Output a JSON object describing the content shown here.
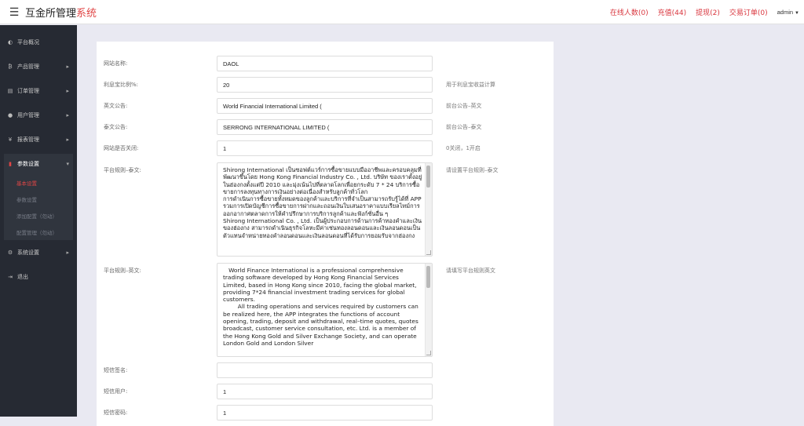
{
  "header": {
    "menu_icon": "hamburger-icon",
    "brand_main": "互金所管理",
    "brand_highlight": "系统",
    "links": [
      "在线人数(0)",
      "充值(44)",
      "提现(2)",
      "交易订单(0)"
    ],
    "user": "admin"
  },
  "sidebar": {
    "items": [
      {
        "label": "平台概况",
        "icon": "gauge-icon"
      },
      {
        "label": "产品管理",
        "icon": "bitcoin-icon"
      },
      {
        "label": "订单管理",
        "icon": "order-icon"
      },
      {
        "label": "用户管理",
        "icon": "user-icon"
      },
      {
        "label": "报表管理",
        "icon": "yen-icon"
      },
      {
        "label": "参数设置",
        "icon": "book-icon"
      },
      {
        "label": "系统设置",
        "icon": "gears-icon"
      },
      {
        "label": "退出",
        "icon": "logout-icon"
      }
    ],
    "subitems": [
      "基本设置",
      "参数设置",
      "添加配置（勿动）",
      "配置管理（勿动）"
    ]
  },
  "form": {
    "site_name": {
      "label": "网站名称:",
      "value": "DAOL",
      "hint": ""
    },
    "interest_rate": {
      "label": "利息宝比例%:",
      "value": "20",
      "hint": "用于利息宝收益计算"
    },
    "en_notice": {
      "label": "英文公告:",
      "value": "World Financial International Limited (",
      "hint": "前台公告–英文"
    },
    "th_notice": {
      "label": "泰文公告:",
      "value": "SERRONG INTERNATIONAL LIMITED (",
      "hint": "前台公告–泰文"
    },
    "site_closed": {
      "label": "网站是否关闭:",
      "value": "1",
      "hint": "0关闭，1开启"
    },
    "rules_th": {
      "label": "平台规则–泰文:",
      "hint": "请设置平台规则–泰文",
      "value": "Shirong International เป็นซอฟต์แวร์การซื้อขายแบบมืออาชีพและครอบคลุมที่พัฒนาขึ้นโดย Hong Kong Financial Industry Co. , Ltd. บริษัท ของเราตั้งอยู่ในฮ่องกงตั้งแต่ปี 2010 และมุ่งเน้นไปที่ตลาดโลกเพื่อยกระดับ 7 * 24 บริการซื้อขายการลงทุนทางการเงินอย่างต่อเนื่องสำหรับลูกค้าทั่วโลก\nการดำเนินการซื้อขายทั้งหมดของลูกค้าและบริการที่จำเป็นสามารถรับรู้ได้ที่ APP รวมการเปิดบัญชีการซื้อขายการฝากและถอนเงินใบเสนอราคาแบบเรียลไทม์การออกอากาศตลาดการให้คำปรึกษาการบริการลูกค้าและฟังก์ชั่นอื่น ๆ\nShirong International Co. , Ltd. เป็นผู้ประกอบการด้านการค้าทองคำและเงินของฮ่องกง สามารถดำเนินธุรกิจโลหะมีค่าเช่นทองลอนดอนและเงินลอนดอนเป็นตัวแทนจำหน่ายทองคำลอนดอนและเงินลอนดอนที่ได้รับการยอมรับจากฮ่องกง"
    },
    "rules_en": {
      "label": "平台规则–英文:",
      "hint": "请填写平台规则英文",
      "value": "   World Finance International is a professional comprehensive trading software developed by Hong Kong Financial Services Limited, based in Hong Kong since 2010, facing the global market, providing 7*24 financial investment trading services for global customers.\n        All trading operations and services required by customers can be realized here, the APP integrates the functions of account opening, trading, deposit and withdrawal, real–time quotes, quotes broadcast, customer service consultation, etc. Ltd. is a member of the Hong Kong Gold and Silver Exchange Society, and can operate London Gold and London Silver"
    },
    "sms_sign": {
      "label": "短信签名:",
      "value": "",
      "hint": ""
    },
    "sms_user": {
      "label": "短信用户:",
      "value": "1",
      "hint": ""
    },
    "sms_password": {
      "label": "短信密码:",
      "value": "1",
      "hint": ""
    }
  },
  "colors": {
    "accent": "#e04646",
    "sidebar_bg": "#262a33",
    "page_bg": "#e9e9f2"
  }
}
